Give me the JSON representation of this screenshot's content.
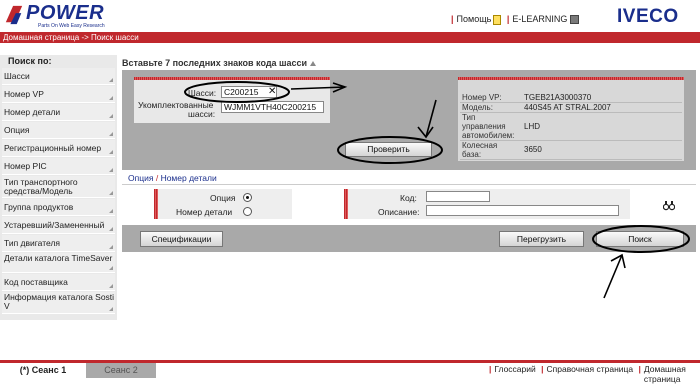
{
  "header": {
    "logo_text": "POWER",
    "logo_tagline": "Parts On Web Easy Research",
    "help_label": "Помощь",
    "elearning_label": "E-LEARNING",
    "brand": "IVECO"
  },
  "breadcrumb": "Домашная страница -> Поиск шасси",
  "sidebar": {
    "title": "Поиск по:",
    "items": [
      "Шасси",
      "Номер VP",
      "Номер детали",
      "Опция",
      "Регистрационный номер",
      "Номер PIC",
      "Тип транспортного средства/Модель",
      "Группа продуктов",
      "Устаревший/Замененный",
      "Тип двигателя",
      "Детали каталога TimeSaver",
      "Код поставщика",
      "Информация каталога Sosti V"
    ]
  },
  "main": {
    "section_title": "Вставьте 7 последних знаков кода шасси",
    "chassis_label": "Шасси:",
    "chassis_value": "C200215",
    "clear_icon": "close-icon",
    "complete_label_1": "Укомплектованные",
    "complete_label_2": "шасси:",
    "complete_value": "WJMM1VTH40C200215",
    "check_button": "Проверить",
    "info": [
      {
        "label": "Номер VP:",
        "value": "TGEB21A3000370"
      },
      {
        "label": "Модель:",
        "value": "440S45 AT STRAL.2007"
      },
      {
        "label": "Тип управления автомобилем:",
        "value": "LHD"
      },
      {
        "label": "Колесная база:",
        "value": "3650"
      }
    ]
  },
  "options": {
    "tab_option": "Опция",
    "tab_sep": "/",
    "tab_part": "Номер детали",
    "radio_option_label": "Опция",
    "radio_part_label": "Номер детали",
    "code_label": "Код:",
    "code_value": "",
    "desc_label": "Описание:",
    "desc_value": ""
  },
  "actions": {
    "spec_button": "Спецификации",
    "reload_button": "Перегрузить",
    "search_button": "Поиск"
  },
  "footer": {
    "session1": "(*) Сеанс 1",
    "session2": "Сеанс 2",
    "glossary": "Глоссарий",
    "reference": "Справочная страница",
    "home_1": "Домашная",
    "home_2": "страница"
  },
  "colors": {
    "accent_red": "#c0282d",
    "brand_blue": "#1a2e8c",
    "panel_gray": "#a9a9a9"
  }
}
